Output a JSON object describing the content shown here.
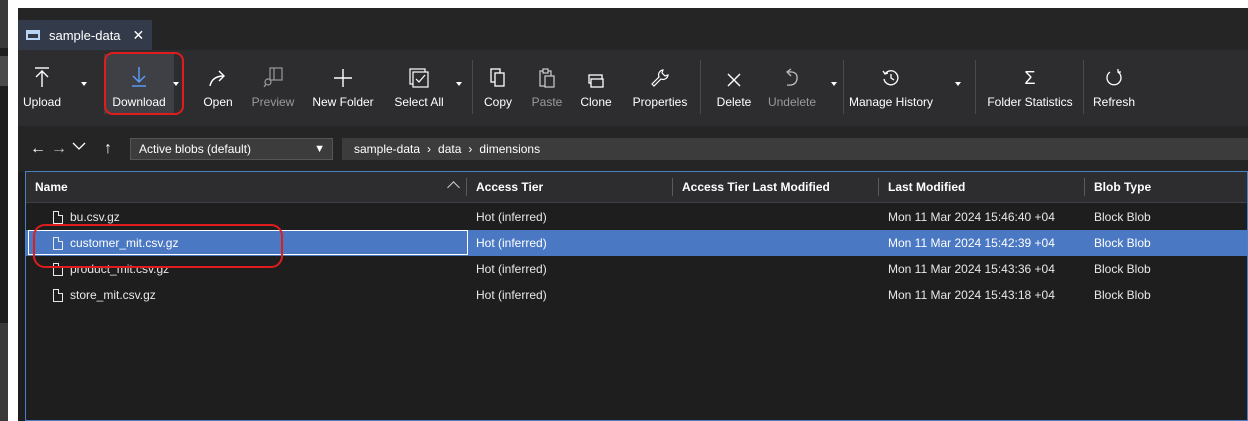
{
  "tab": {
    "title": "sample-data",
    "close": "✕"
  },
  "toolbar": {
    "upload": "Upload",
    "download": "Download",
    "open": "Open",
    "preview": "Preview",
    "new_folder": "New Folder",
    "select_all": "Select All",
    "copy": "Copy",
    "paste": "Paste",
    "clone": "Clone",
    "properties": "Properties",
    "delete": "Delete",
    "undelete": "Undelete",
    "manage_history": "Manage History",
    "folder_statistics": "Folder Statistics",
    "refresh": "Refresh"
  },
  "nav": {
    "filter_value": "Active blobs (default)",
    "breadcrumb": [
      "sample-data",
      "data",
      "dimensions"
    ]
  },
  "table": {
    "columns": [
      "Name",
      "Access Tier",
      "Access Tier Last Modified",
      "Last Modified",
      "Blob Type"
    ],
    "rows": [
      {
        "name": "bu.csv.gz",
        "tier": "Hot (inferred)",
        "tier_modified": "",
        "modified": "Mon 11 Mar 2024 15:46:40 +04",
        "type": "Block Blob"
      },
      {
        "name": "customer_mit.csv.gz",
        "tier": "Hot (inferred)",
        "tier_modified": "",
        "modified": "Mon 11 Mar 2024 15:42:39 +04",
        "type": "Block Blob"
      },
      {
        "name": "product_mit.csv.gz",
        "tier": "Hot (inferred)",
        "tier_modified": "",
        "modified": "Mon 11 Mar 2024 15:43:36 +04",
        "type": "Block Blob"
      },
      {
        "name": "store_mit.csv.gz",
        "tier": "Hot (inferred)",
        "tier_modified": "",
        "modified": "Mon 11 Mar 2024 15:43:18 +04",
        "type": "Block Blob"
      }
    ],
    "selected_row": 1
  },
  "colors": {
    "selection": "#4a78c2",
    "annotation": "#e01c1c",
    "background": "#1e1e1e"
  }
}
